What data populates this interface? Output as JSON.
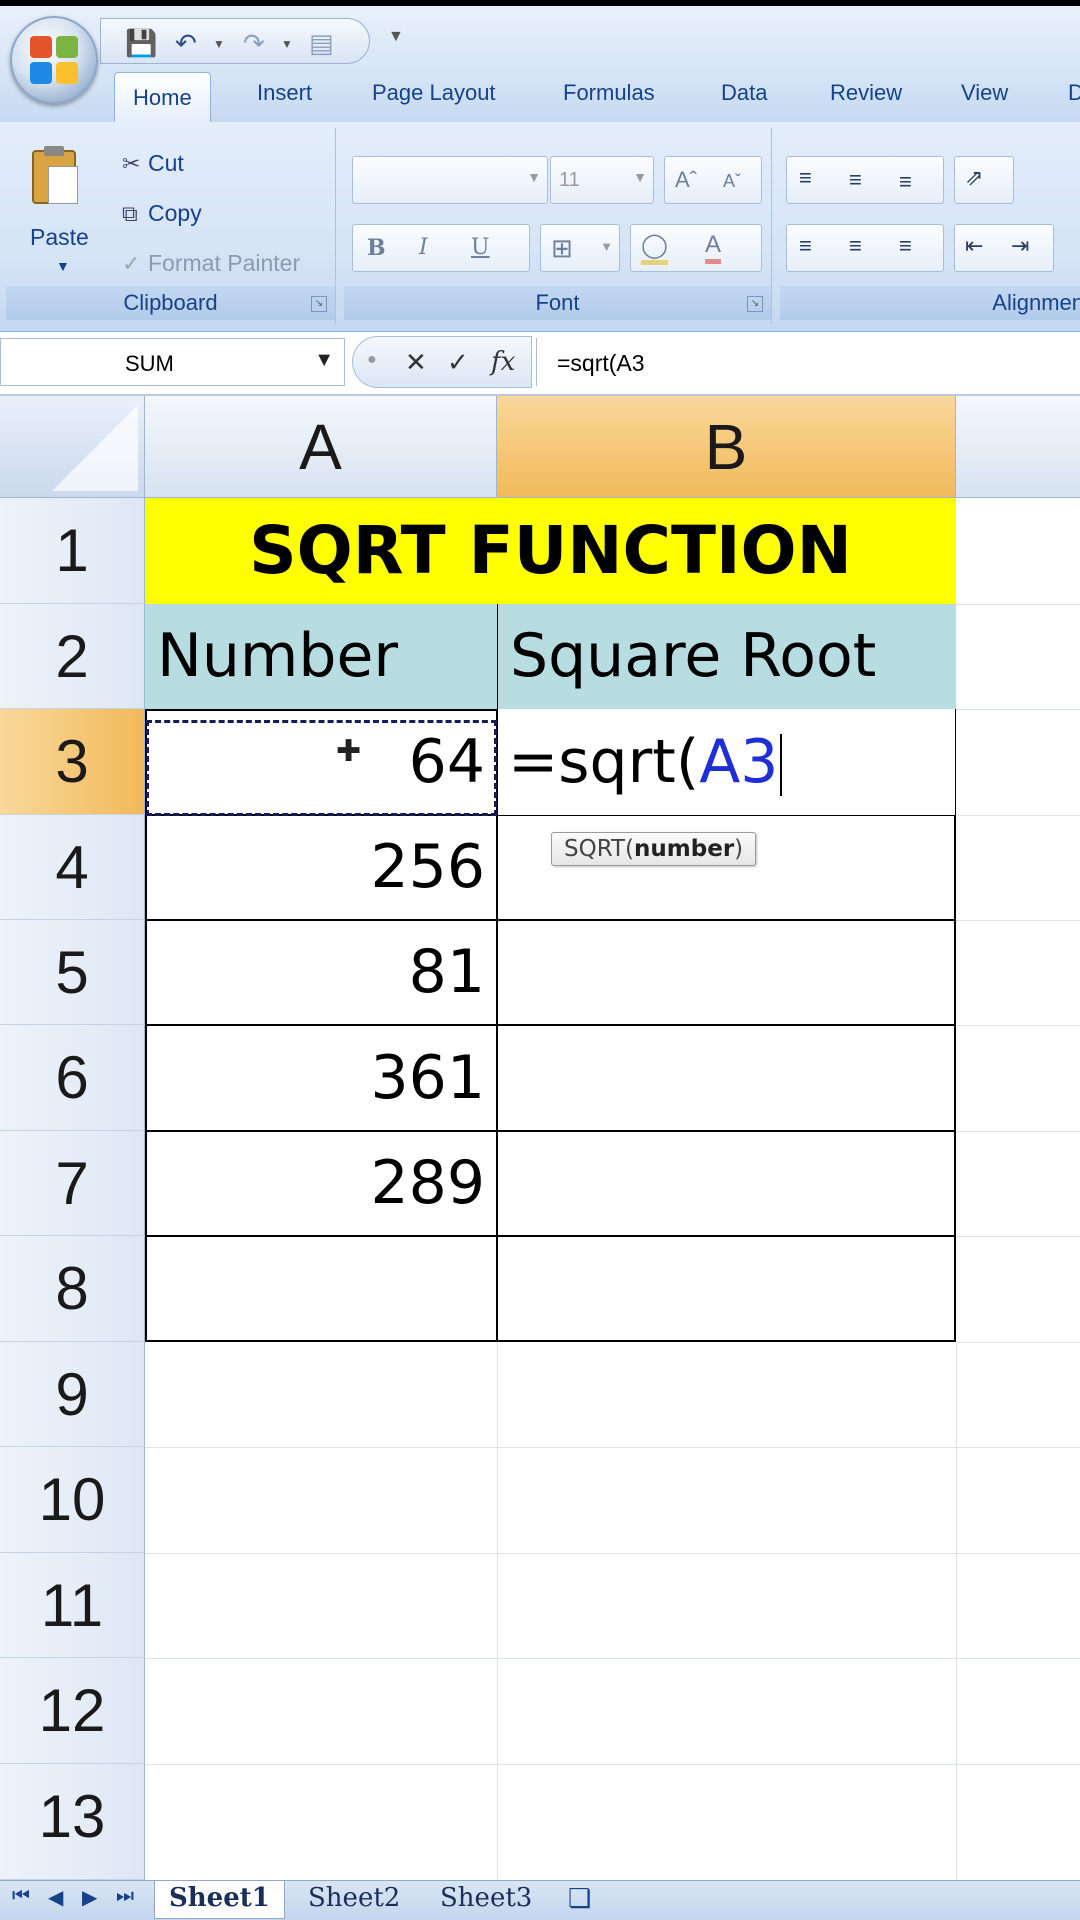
{
  "quick_access": {
    "save_icon": "save-icon",
    "undo_icon": "undo-icon",
    "redo_icon": "redo-icon",
    "customize_icon": "customize-icon"
  },
  "tabs": [
    "Home",
    "Insert",
    "Page Layout",
    "Formulas",
    "Data",
    "Review",
    "View",
    "D"
  ],
  "ribbon": {
    "clipboard": {
      "paste": "Paste",
      "cut": "Cut",
      "copy": "Copy",
      "format_painter": "Format Painter",
      "label": "Clipboard"
    },
    "font": {
      "font_name": "",
      "font_size": "11",
      "bold": "B",
      "italic": "I",
      "underline": "U",
      "label": "Font"
    },
    "alignment": {
      "label": "Alignmen"
    }
  },
  "formula_bar": {
    "name_box": "SUM",
    "cancel": "✕",
    "enter": "✓",
    "fx": "fx",
    "formula": "=sqrt(A3"
  },
  "columns": [
    "A",
    "B"
  ],
  "rows": [
    "1",
    "2",
    "3",
    "4",
    "5",
    "6",
    "7",
    "8",
    "9",
    "10",
    "11",
    "12",
    "13"
  ],
  "cells": {
    "title": "SQRT FUNCTION",
    "header_a": "Number",
    "header_b": "Square Root",
    "numbers": [
      "64",
      "256",
      "81",
      "361",
      "289"
    ],
    "editing_prefix": "=sqrt(",
    "editing_ref": "A3"
  },
  "tooltip": {
    "func": "SQRT(",
    "arg": "number",
    "close": ")"
  },
  "sheets": [
    "Sheet1",
    "Sheet2",
    "Sheet3"
  ],
  "colors": {
    "title_fill": "#ffff00",
    "header_fill": "#b7dde1",
    "selection_header": "#f1b95a",
    "ref_blue": "#1f2fd6"
  }
}
